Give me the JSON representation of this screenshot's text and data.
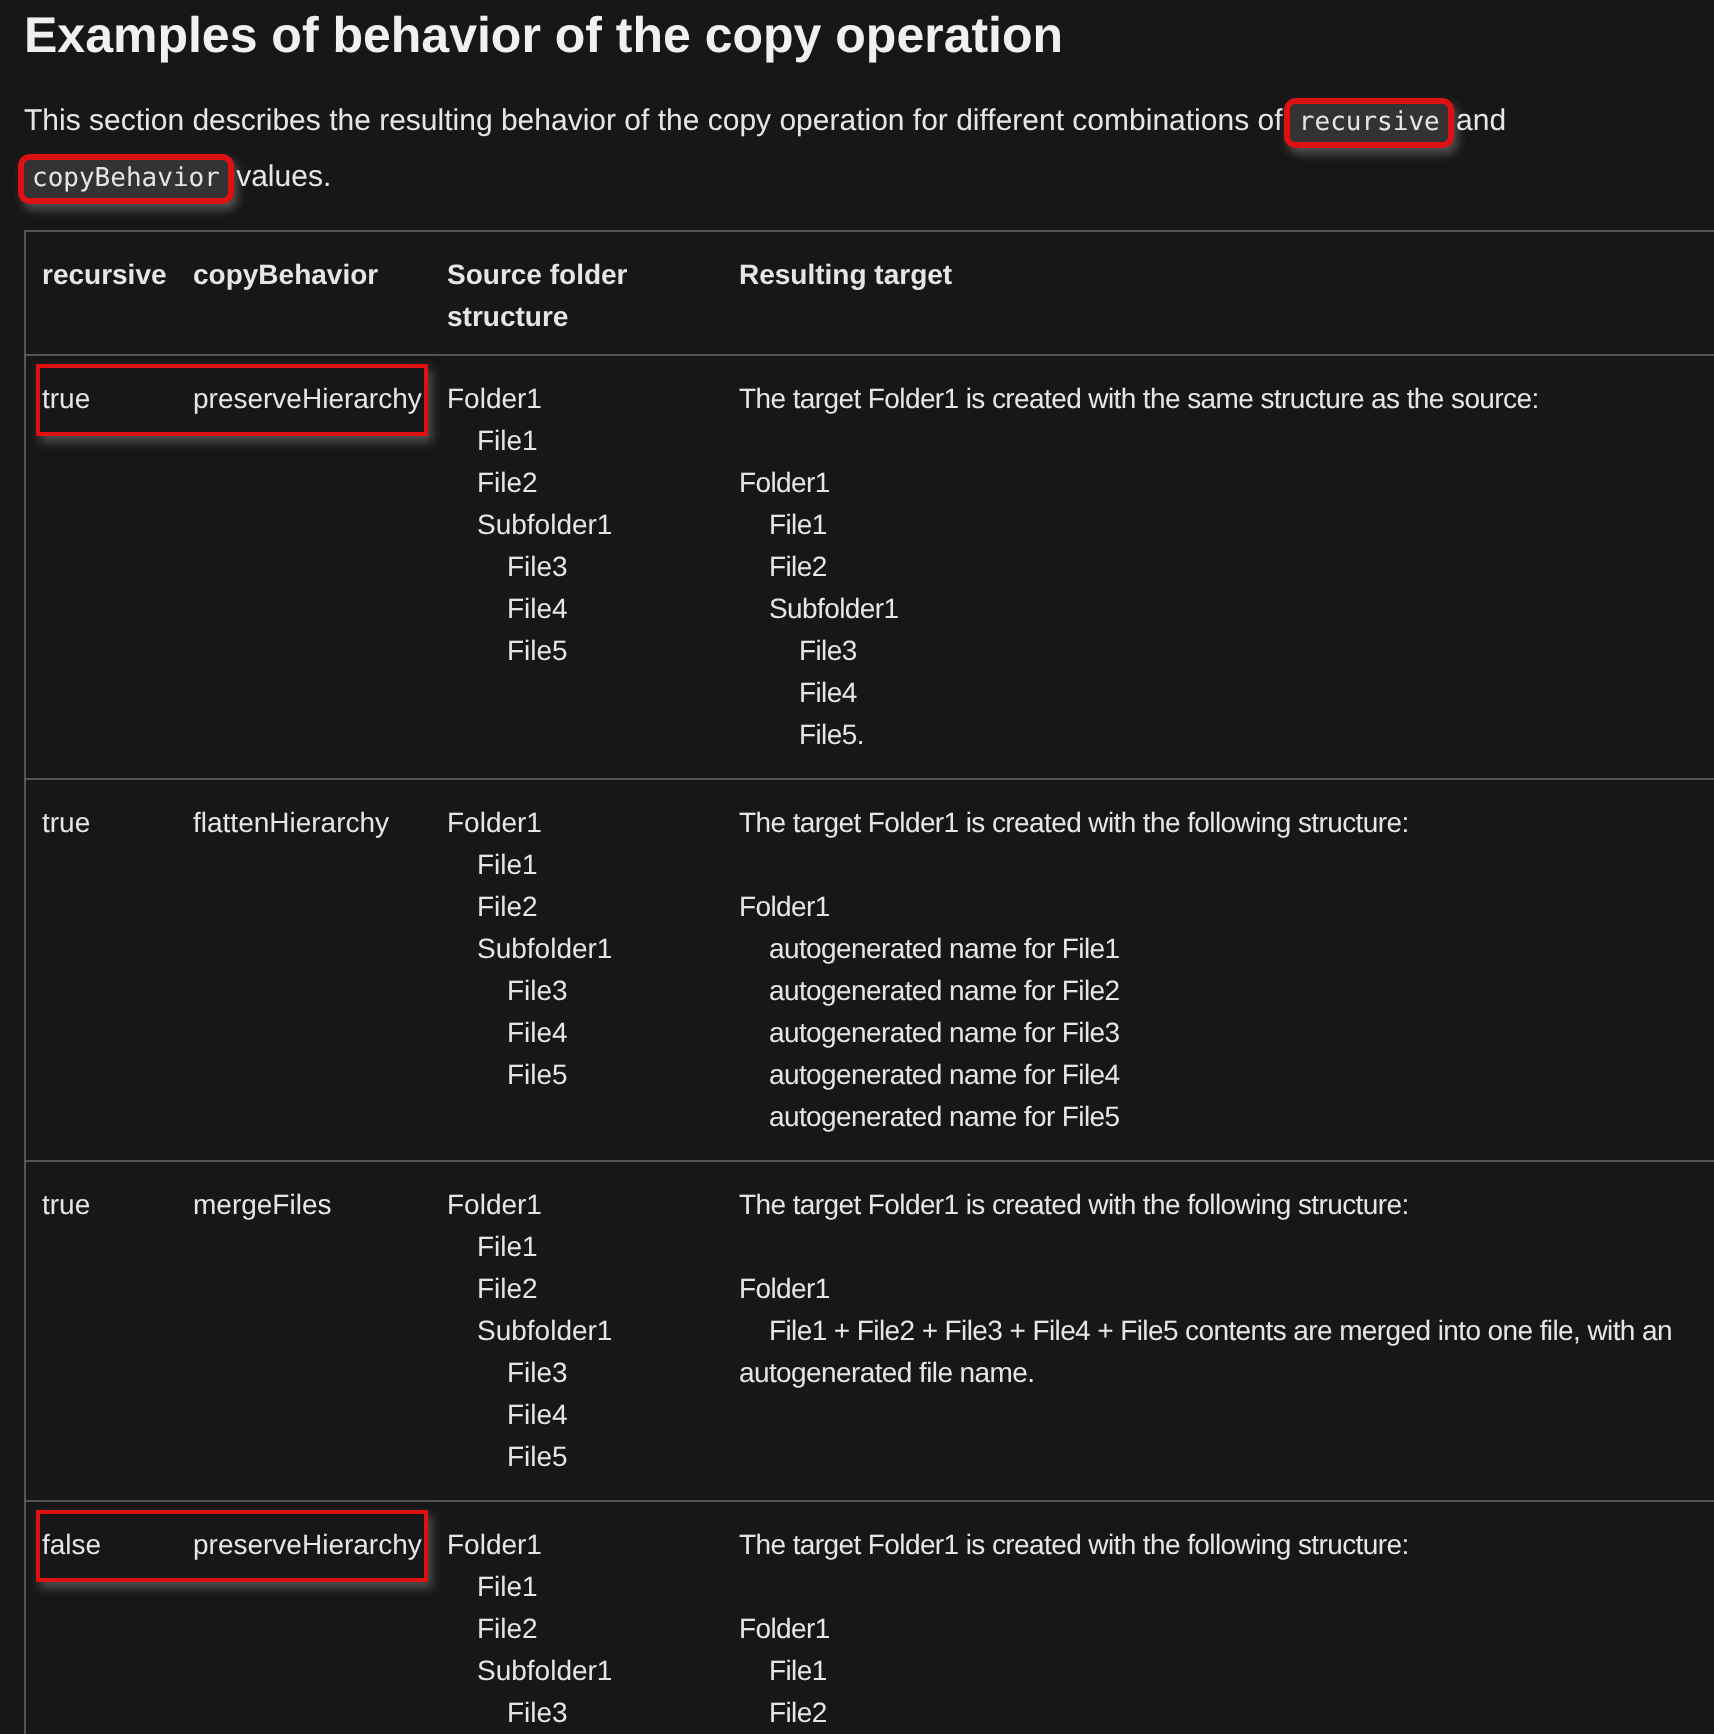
{
  "heading": "Examples of behavior of the copy operation",
  "intro": {
    "parts": [
      {
        "kind": "text",
        "text": "This section describes the resulting behavior of the copy operation for different combinations of "
      },
      {
        "kind": "code",
        "text": "recursive",
        "highlighted": true
      },
      {
        "kind": "text",
        "text": " and "
      },
      {
        "kind": "code",
        "text": "copyBehavior",
        "highlighted": true
      },
      {
        "kind": "text",
        "text": " values."
      }
    ]
  },
  "table": {
    "columns": [
      "recursive",
      "copyBehavior",
      "Source folder structure",
      "Resulting target"
    ],
    "rows": [
      {
        "recursive": "true",
        "copyBehavior": "preserveHierarchy",
        "highlighted": true,
        "source": [
          {
            "name": "Folder1",
            "children": [
              {
                "name": "File1"
              },
              {
                "name": "File2"
              },
              {
                "name": "Subfolder1",
                "children": [
                  {
                    "name": "File3"
                  },
                  {
                    "name": "File4"
                  },
                  {
                    "name": "File5"
                  }
                ]
              }
            ]
          }
        ],
        "result_intro": "The target Folder1 is created with the same structure as the source:",
        "result": [
          {
            "name": "Folder1",
            "children": [
              {
                "name": "File1"
              },
              {
                "name": "File2"
              },
              {
                "name": "Subfolder1",
                "children": [
                  {
                    "name": "File3"
                  },
                  {
                    "name": "File4"
                  },
                  {
                    "name": "File5."
                  }
                ]
              }
            ]
          }
        ]
      },
      {
        "recursive": "true",
        "copyBehavior": "flattenHierarchy",
        "highlighted": false,
        "source": [
          {
            "name": "Folder1",
            "children": [
              {
                "name": "File1"
              },
              {
                "name": "File2"
              },
              {
                "name": "Subfolder1",
                "children": [
                  {
                    "name": "File3"
                  },
                  {
                    "name": "File4"
                  },
                  {
                    "name": "File5"
                  }
                ]
              }
            ]
          }
        ],
        "result_intro": "The target Folder1 is created with the following structure:",
        "result": [
          {
            "name": "Folder1",
            "children": [
              {
                "name": "autogenerated name for File1"
              },
              {
                "name": "autogenerated name for File2"
              },
              {
                "name": "autogenerated name for File3"
              },
              {
                "name": "autogenerated name for File4"
              },
              {
                "name": "autogenerated name for File5"
              }
            ]
          }
        ]
      },
      {
        "recursive": "true",
        "copyBehavior": "mergeFiles",
        "highlighted": false,
        "source": [
          {
            "name": "Folder1",
            "children": [
              {
                "name": "File1"
              },
              {
                "name": "File2"
              },
              {
                "name": "Subfolder1",
                "children": [
                  {
                    "name": "File3"
                  },
                  {
                    "name": "File4"
                  },
                  {
                    "name": "File5"
                  }
                ]
              }
            ]
          }
        ],
        "result_intro": "The target Folder1 is created with the following structure:",
        "result": [
          {
            "name": "Folder1",
            "children": [
              {
                "name": "File1 + File2 + File3 + File4 + File5 contents are merged into one file, with an autogenerated file name."
              }
            ]
          }
        ]
      },
      {
        "recursive": "false",
        "copyBehavior": "preserveHierarchy",
        "highlighted": true,
        "source": [
          {
            "name": "Folder1",
            "children": [
              {
                "name": "File1"
              },
              {
                "name": "File2"
              },
              {
                "name": "Subfolder1",
                "children": [
                  {
                    "name": "File3"
                  }
                ]
              }
            ]
          }
        ],
        "result_intro": "The target Folder1 is created with the following structure:",
        "result": [
          {
            "name": "Folder1",
            "children": [
              {
                "name": "File1"
              },
              {
                "name": "File2"
              }
            ]
          }
        ]
      }
    ]
  }
}
